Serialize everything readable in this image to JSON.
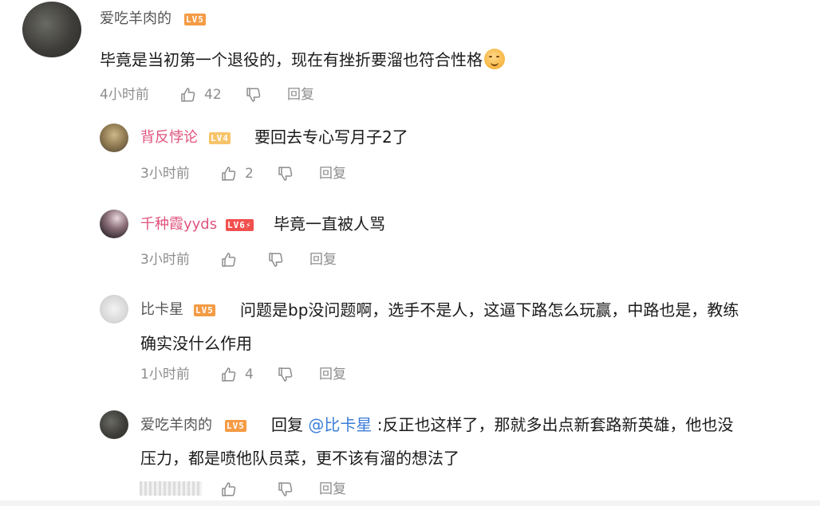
{
  "comments": [
    {
      "username": "爱吃羊肉的",
      "level": "LV5",
      "content_lines": [
        "毕竟是当初第一个退役的，现在有挫折要溜也符合性格"
      ],
      "emoji": "smiling-face-emoji",
      "time": "4小时前",
      "likes": "42",
      "reply_label": "回复"
    },
    {
      "username": "背反悖论",
      "level": "LV4",
      "content_lines": [
        "要回去专心写月子2了"
      ],
      "time": "3小时前",
      "likes": "2",
      "reply_label": "回复"
    },
    {
      "username": "千种霞yyds",
      "level": "LV6⚡",
      "content_lines": [
        "毕竟一直被人骂"
      ],
      "time": "3小时前",
      "likes": "",
      "reply_label": "回复"
    },
    {
      "username": "比卡星",
      "level": "LV5",
      "content_lines": [
        "问题是bp没问题啊，选手不是人，这逼下路怎么玩赢，中路也是，教练",
        "确实没什么作用"
      ],
      "time": "1小时前",
      "likes": "4",
      "reply_label": "回复"
    },
    {
      "username": "爱吃羊肉的",
      "level": "LV5",
      "reply_prefix": "回复",
      "mention": "@比卡星",
      "content_lines": [
        ":反正也这样了，那就多出点新套路新英雄，他也没",
        "压力，都是喷他队员菜，更不该有溜的想法了"
      ],
      "time": "",
      "likes": "",
      "reply_label": "回复"
    }
  ],
  "icons": {
    "like": "thumbs-up-icon",
    "dislike": "thumbs-down-icon"
  },
  "colors": {
    "username_pink": "#e0537d",
    "username_gray": "#555555",
    "mention_blue": "#3b7ed8",
    "meta_gray": "#8d8d8d",
    "level5": "#f59b45",
    "level4": "#f7c36a",
    "level6": "#f24f4f"
  }
}
